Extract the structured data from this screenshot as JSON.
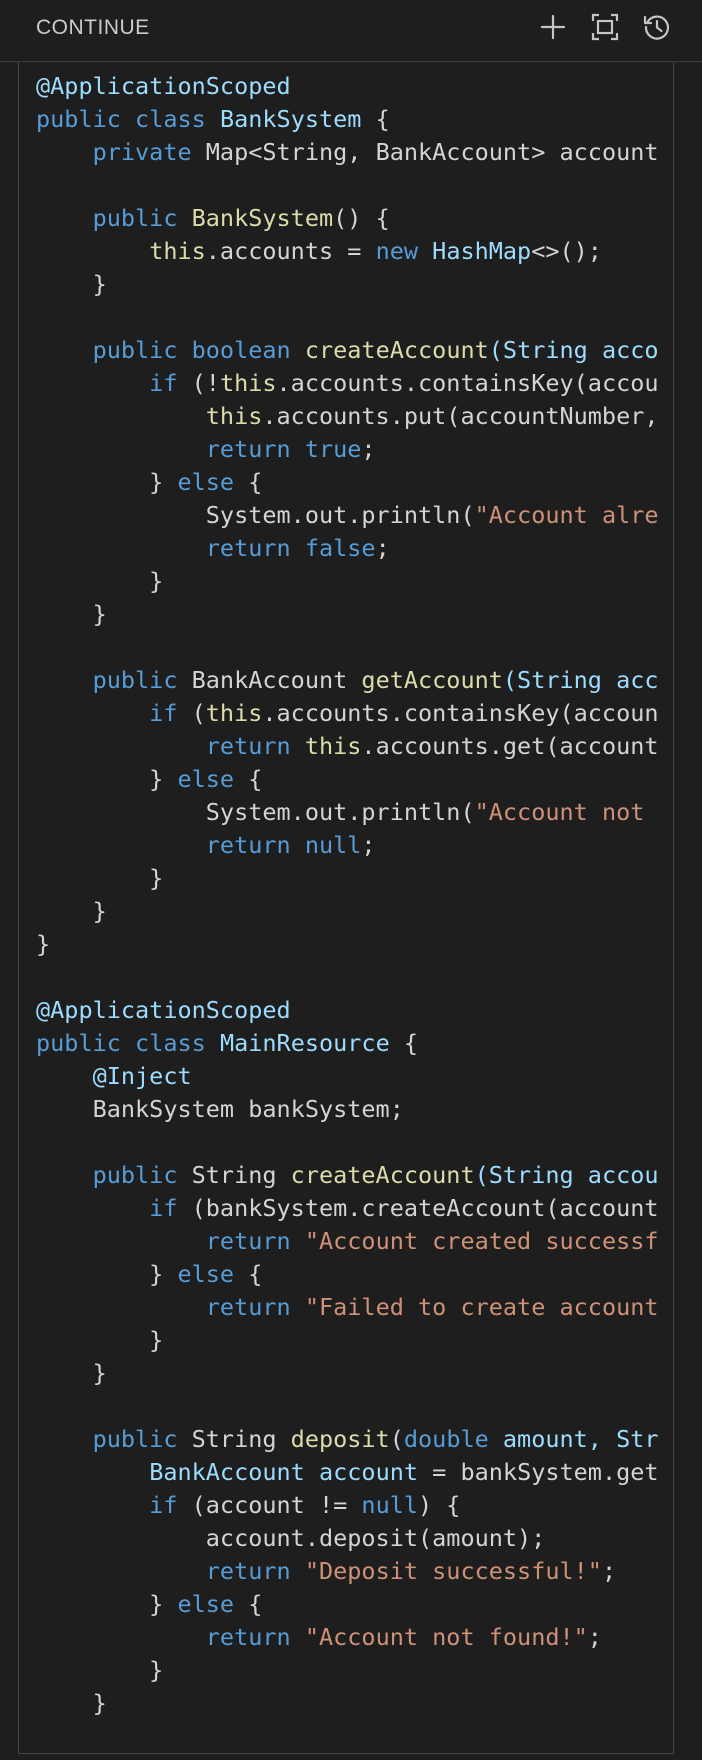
{
  "header": {
    "title": "CONTINUE",
    "actions": [
      {
        "name": "new",
        "icon": "plus-icon"
      },
      {
        "name": "fullscreen",
        "icon": "fullscreen-icon"
      },
      {
        "name": "history",
        "icon": "history-icon"
      }
    ]
  },
  "code": {
    "lines": [
      [
        [
          "@ApplicationScoped",
          "ann"
        ]
      ],
      [
        [
          "public",
          "keyword"
        ],
        [
          " ",
          "plain"
        ],
        [
          "class",
          "keyword"
        ],
        [
          " ",
          "plain"
        ],
        [
          "BankSystem",
          "class"
        ],
        [
          " {",
          "plain"
        ]
      ],
      [
        [
          "    ",
          "plain"
        ],
        [
          "private",
          "keyword"
        ],
        [
          " Map<String, BankAccount> account",
          "plain"
        ]
      ],
      [],
      [
        [
          "    ",
          "plain"
        ],
        [
          "public",
          "keyword"
        ],
        [
          " ",
          "plain"
        ],
        [
          "BankSystem",
          "func"
        ],
        [
          "() {",
          "plain"
        ]
      ],
      [
        [
          "        ",
          "plain"
        ],
        [
          "this",
          "this"
        ],
        [
          ".accounts = ",
          "plain"
        ],
        [
          "new",
          "keyword"
        ],
        [
          " ",
          "plain"
        ],
        [
          "HashMap",
          "class"
        ],
        [
          "<>();",
          "plain"
        ]
      ],
      [
        [
          "    }",
          "plain"
        ]
      ],
      [],
      [
        [
          "    ",
          "plain"
        ],
        [
          "public",
          "keyword"
        ],
        [
          " ",
          "plain"
        ],
        [
          "boolean",
          "keyword"
        ],
        [
          " ",
          "plain"
        ],
        [
          "createAccount",
          "func"
        ],
        [
          "(String acco",
          "var"
        ]
      ],
      [
        [
          "        ",
          "plain"
        ],
        [
          "if",
          "control"
        ],
        [
          " (!",
          "plain"
        ],
        [
          "this",
          "this"
        ],
        [
          ".accounts.containsKey(accou",
          "plain"
        ]
      ],
      [
        [
          "            ",
          "plain"
        ],
        [
          "this",
          "this"
        ],
        [
          ".accounts.put(accountNumber,",
          "plain"
        ]
      ],
      [
        [
          "            ",
          "plain"
        ],
        [
          "return",
          "control"
        ],
        [
          " ",
          "plain"
        ],
        [
          "true",
          "keyword"
        ],
        [
          ";",
          "plain"
        ]
      ],
      [
        [
          "        } ",
          "plain"
        ],
        [
          "else",
          "control"
        ],
        [
          " {",
          "plain"
        ]
      ],
      [
        [
          "            System.out.println(",
          "plain"
        ],
        [
          "\"Account alre",
          "string"
        ]
      ],
      [
        [
          "            ",
          "plain"
        ],
        [
          "return",
          "control"
        ],
        [
          " ",
          "plain"
        ],
        [
          "false",
          "keyword"
        ],
        [
          ";",
          "plain"
        ]
      ],
      [
        [
          "        }",
          "plain"
        ]
      ],
      [
        [
          "    }",
          "plain"
        ]
      ],
      [],
      [
        [
          "    ",
          "plain"
        ],
        [
          "public",
          "keyword"
        ],
        [
          " BankAccount ",
          "plain"
        ],
        [
          "getAccount",
          "func"
        ],
        [
          "(String acc",
          "var"
        ]
      ],
      [
        [
          "        ",
          "plain"
        ],
        [
          "if",
          "control"
        ],
        [
          " (",
          "plain"
        ],
        [
          "this",
          "this"
        ],
        [
          ".accounts.containsKey(accoun",
          "plain"
        ]
      ],
      [
        [
          "            ",
          "plain"
        ],
        [
          "return",
          "control"
        ],
        [
          " ",
          "plain"
        ],
        [
          "this",
          "this"
        ],
        [
          ".accounts.get(account",
          "plain"
        ]
      ],
      [
        [
          "        } ",
          "plain"
        ],
        [
          "else",
          "control"
        ],
        [
          " {",
          "plain"
        ]
      ],
      [
        [
          "            System.out.println(",
          "plain"
        ],
        [
          "\"Account not ",
          "string"
        ]
      ],
      [
        [
          "            ",
          "plain"
        ],
        [
          "return",
          "control"
        ],
        [
          " ",
          "plain"
        ],
        [
          "null",
          "keyword"
        ],
        [
          ";",
          "plain"
        ]
      ],
      [
        [
          "        }",
          "plain"
        ]
      ],
      [
        [
          "    }",
          "plain"
        ]
      ],
      [
        [
          "}",
          "plain"
        ]
      ],
      [],
      [
        [
          "@ApplicationScoped",
          "ann"
        ]
      ],
      [
        [
          "public",
          "keyword"
        ],
        [
          " ",
          "plain"
        ],
        [
          "class",
          "keyword"
        ],
        [
          " ",
          "plain"
        ],
        [
          "MainResource",
          "class"
        ],
        [
          " {",
          "plain"
        ]
      ],
      [
        [
          "    ",
          "plain"
        ],
        [
          "@Inject",
          "ann"
        ]
      ],
      [
        [
          "    BankSystem bankSystem;",
          "plain"
        ]
      ],
      [],
      [
        [
          "    ",
          "plain"
        ],
        [
          "public",
          "keyword"
        ],
        [
          " String ",
          "plain"
        ],
        [
          "createAccount",
          "func"
        ],
        [
          "(String accou",
          "var"
        ]
      ],
      [
        [
          "        ",
          "plain"
        ],
        [
          "if",
          "control"
        ],
        [
          " (bankSystem.createAccount(account",
          "plain"
        ]
      ],
      [
        [
          "            ",
          "plain"
        ],
        [
          "return",
          "control"
        ],
        [
          " ",
          "plain"
        ],
        [
          "\"Account created successf",
          "string"
        ]
      ],
      [
        [
          "        } ",
          "plain"
        ],
        [
          "else",
          "control"
        ],
        [
          " {",
          "plain"
        ]
      ],
      [
        [
          "            ",
          "plain"
        ],
        [
          "return",
          "control"
        ],
        [
          " ",
          "plain"
        ],
        [
          "\"Failed to create account",
          "string"
        ]
      ],
      [
        [
          "        }",
          "plain"
        ]
      ],
      [
        [
          "    }",
          "plain"
        ]
      ],
      [],
      [
        [
          "    ",
          "plain"
        ],
        [
          "public",
          "keyword"
        ],
        [
          " String ",
          "plain"
        ],
        [
          "deposit",
          "func"
        ],
        [
          "(",
          "plain"
        ],
        [
          "double",
          "keyword"
        ],
        [
          " amount, Str",
          "var"
        ]
      ],
      [
        [
          "        ",
          "plain"
        ],
        [
          "BankAccount",
          "class"
        ],
        [
          " ",
          "plain"
        ],
        [
          "account",
          "var"
        ],
        [
          " = bankSystem.get",
          "plain"
        ]
      ],
      [
        [
          "        ",
          "plain"
        ],
        [
          "if",
          "control"
        ],
        [
          " (account != ",
          "plain"
        ],
        [
          "null",
          "keyword"
        ],
        [
          ") {",
          "plain"
        ]
      ],
      [
        [
          "            account.deposit(amount);",
          "plain"
        ]
      ],
      [
        [
          "            ",
          "plain"
        ],
        [
          "return",
          "control"
        ],
        [
          " ",
          "plain"
        ],
        [
          "\"Deposit successful!\"",
          "string"
        ],
        [
          ";",
          "plain"
        ]
      ],
      [
        [
          "        } ",
          "plain"
        ],
        [
          "else",
          "control"
        ],
        [
          " {",
          "plain"
        ]
      ],
      [
        [
          "            ",
          "plain"
        ],
        [
          "return",
          "control"
        ],
        [
          " ",
          "plain"
        ],
        [
          "\"Account not found!\"",
          "string"
        ],
        [
          ";",
          "plain"
        ]
      ],
      [
        [
          "        }",
          "plain"
        ]
      ],
      [
        [
          "    }",
          "plain"
        ]
      ]
    ]
  }
}
